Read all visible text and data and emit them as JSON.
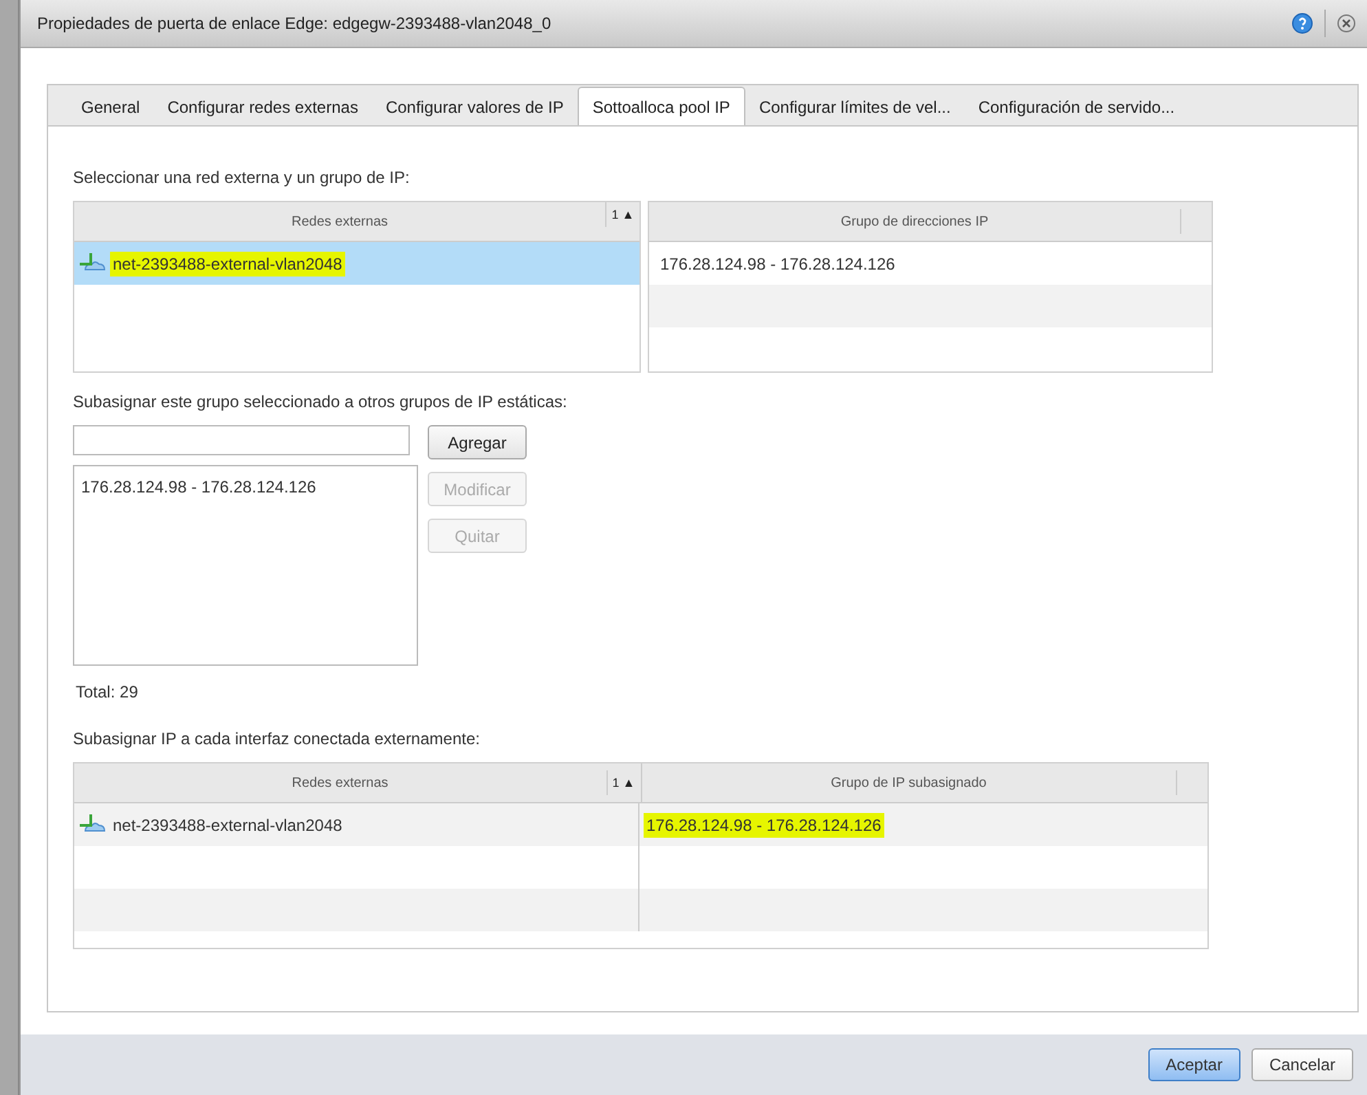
{
  "window": {
    "title": "Propiedades de puerta de enlace Edge: edgegw-2393488-vlan2048_0"
  },
  "tabs": [
    {
      "label": "General",
      "selected": false
    },
    {
      "label": "Configurar redes externas",
      "selected": false
    },
    {
      "label": "Configurar valores de IP",
      "selected": false
    },
    {
      "label": "Sottoalloca pool IP",
      "selected": true
    },
    {
      "label": "Configurar límites de vel...",
      "selected": false
    },
    {
      "label": "Configuración de servido...",
      "selected": false
    }
  ],
  "select_label": "Seleccionar una red externa y un grupo de IP:",
  "networks_table": {
    "column": "Redes externas",
    "sort": "1 ▲",
    "rows": [
      {
        "name": "net-2393488-external-vlan2048",
        "selected": true,
        "highlighted": true
      }
    ]
  },
  "pool_table": {
    "column": "Grupo de direcciones IP",
    "rows": [
      {
        "range": "176.28.124.98 - 176.28.124.126"
      }
    ]
  },
  "suballocate_label": "Subasignar este grupo seleccionado a otros grupos de IP estáticas:",
  "ranges_list": [
    "176.28.124.98 - 176.28.124.126"
  ],
  "list_buttons": [
    {
      "label": "Agregar",
      "disabled": false
    },
    {
      "label": "Modificar",
      "disabled": true
    },
    {
      "label": "Quitar",
      "disabled": true
    }
  ],
  "total": "Total: 29",
  "interfaces_label": "Subasignar IP a cada interfaz conectada externamente:",
  "interfaces_table": {
    "columns": [
      "Redes externas",
      "Grupo de IP subasignado"
    ],
    "sort": "1 ▲",
    "rows": [
      {
        "network": "net-2393488-external-vlan2048",
        "pool": "176.28.124.98 - 176.28.124.126",
        "highlighted": true
      }
    ]
  },
  "footer_buttons": [
    {
      "label": "Aceptar",
      "primary": true
    },
    {
      "label": "Cancelar",
      "primary": false
    }
  ]
}
